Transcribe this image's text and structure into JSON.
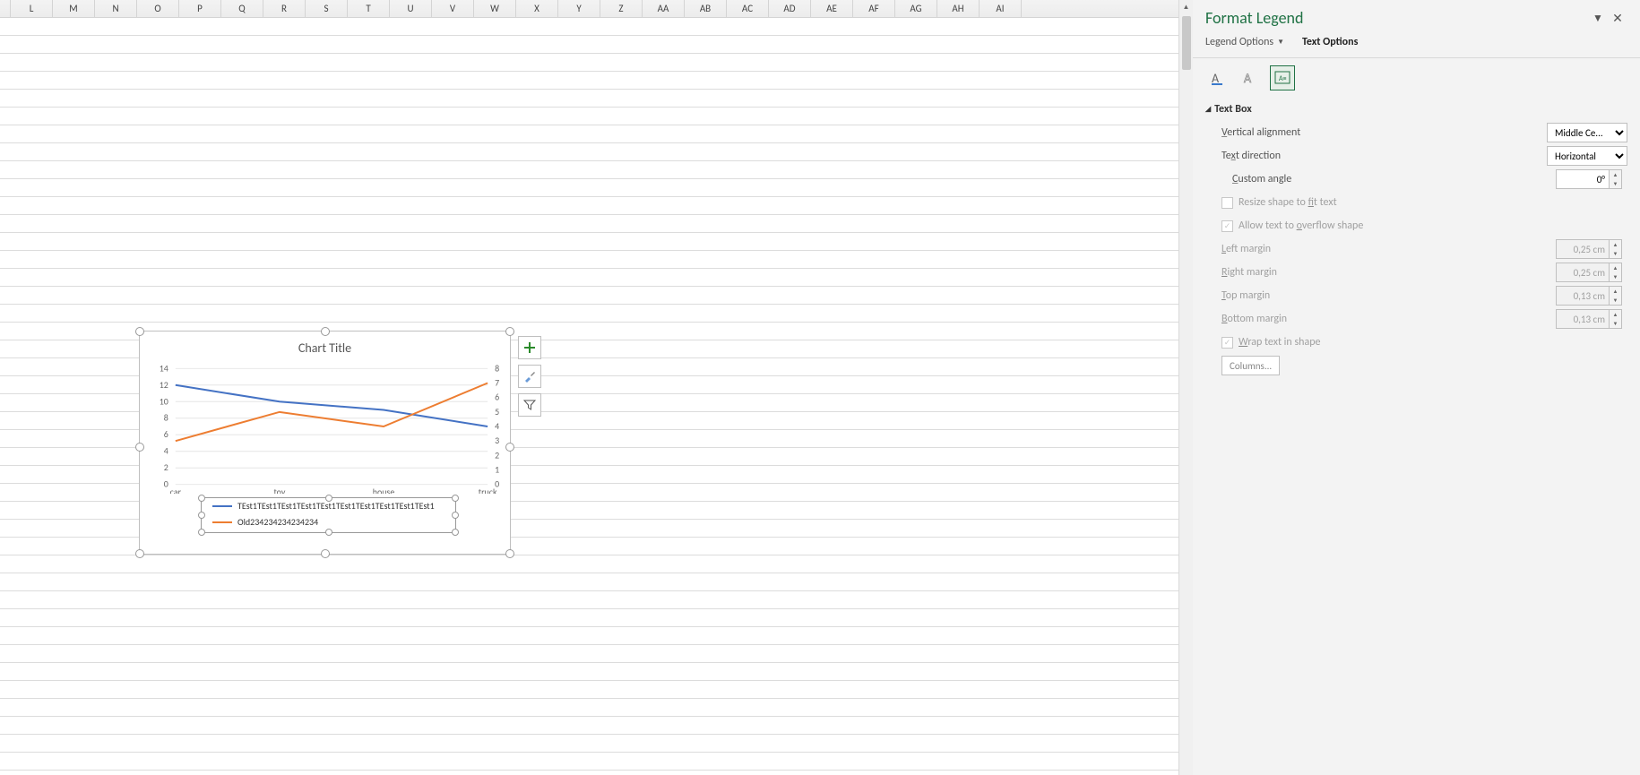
{
  "columns": [
    "L",
    "M",
    "N",
    "O",
    "P",
    "Q",
    "R",
    "S",
    "T",
    "U",
    "V",
    "W",
    "X",
    "Y",
    "Z",
    "AA",
    "AB",
    "AC",
    "AD",
    "AE",
    "AF",
    "AG",
    "AH",
    "AI"
  ],
  "chart": {
    "title": "Chart Title",
    "side_buttons": [
      "plus",
      "brush",
      "funnel"
    ]
  },
  "chart_data": {
    "type": "line",
    "categories": [
      "car",
      "toy",
      "house",
      "truck"
    ],
    "series": [
      {
        "name": "TEst1TEst1TEst1TEst1TEst1TEst1TEst1TEst1TEst1TEst1",
        "values": [
          12,
          10,
          9,
          7
        ],
        "axis": "primary",
        "color": "#4472c4"
      },
      {
        "name": "Old234234234234234",
        "values": [
          3,
          5,
          4,
          7
        ],
        "axis": "secondary",
        "color": "#ed7d31"
      }
    ],
    "primary_axis": {
      "min": 0,
      "max": 14,
      "step": 2,
      "ticks": [
        0,
        2,
        4,
        6,
        8,
        10,
        12,
        14
      ]
    },
    "secondary_axis": {
      "min": 0,
      "max": 8,
      "step": 1,
      "ticks": [
        0,
        1,
        2,
        3,
        4,
        5,
        6,
        7,
        8
      ]
    },
    "title": "Chart Title",
    "legend_position": "bottom"
  },
  "pane": {
    "title": "Format Legend",
    "tabs": {
      "legend_options": "Legend Options",
      "text_options": "Text Options"
    },
    "section": "Text Box",
    "fields": {
      "vertical_alignment": {
        "label": "Vertical alignment",
        "value": "Middle Ce..."
      },
      "text_direction": {
        "label": "Text direction",
        "value": "Horizontal"
      },
      "custom_angle": {
        "label": "Custom angle",
        "value": "0°"
      },
      "resize_to_fit": {
        "label": "Resize shape to fit text",
        "checked": false,
        "disabled": true
      },
      "allow_overflow": {
        "label": "Allow text to overflow shape",
        "checked": true,
        "disabled": true
      },
      "left_margin": {
        "label": "Left margin",
        "value": "0,25 cm"
      },
      "right_margin": {
        "label": "Right margin",
        "value": "0,25 cm"
      },
      "top_margin": {
        "label": "Top margin",
        "value": "0,13 cm"
      },
      "bottom_margin": {
        "label": "Bottom margin",
        "value": "0,13 cm"
      },
      "wrap_text": {
        "label": "Wrap text in shape",
        "checked": true,
        "disabled": true
      },
      "columns_btn": "Columns..."
    }
  }
}
